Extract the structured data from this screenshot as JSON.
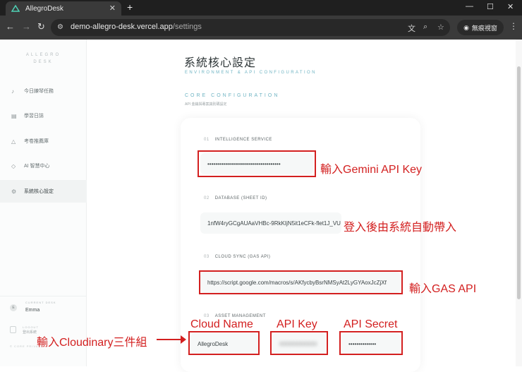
{
  "browser": {
    "tab_title": "AllegroDesk",
    "tab_close": "✕",
    "new_tab": "+",
    "url_host": "demo-allegro-desk.vercel.app",
    "url_path": "/settings",
    "incognito_label": "無痕視窗",
    "window_controls": [
      "—",
      "☐",
      "✕"
    ]
  },
  "sidebar": {
    "brand_line1": "ALLEGRO",
    "brand_line2": "DESK",
    "items": [
      {
        "label": "今日練琴任務",
        "icon": "music-icon"
      },
      {
        "label": "學習日誌",
        "icon": "journal-icon"
      },
      {
        "label": "考卷推薦庫",
        "icon": "mountain-icon"
      },
      {
        "label": "AI 智慧中心",
        "icon": "ai-icon"
      },
      {
        "label": "系統核心設定",
        "icon": "gear-icon",
        "active": true
      }
    ],
    "user_caption": "CURRENT DESK",
    "user_name": "Emma",
    "logout_caption": "LOGOUT",
    "logout_label": "登出系統",
    "footer": "© CORE PRIVATE"
  },
  "main": {
    "title": "系統核心設定",
    "subtitle": "ENVIRONMENT & API CONFIGURATION",
    "section_title": "CORE CONFIGURATION",
    "section_desc": "API 金鑰與專案識別碼設定",
    "fields": [
      {
        "num": "01",
        "label": "INTELLIGENCE SERVICE",
        "value": "•••••••••••••••••••••••••••••••••••••"
      },
      {
        "num": "02",
        "label": "DATABASE (SHEET ID)",
        "value": "1nfW4ryGCgAUAaVHBc-9RkKIjN5it1eCFk-flet1J_VU"
      },
      {
        "num": "03",
        "label": "CLOUD SYNC (GAS API)",
        "value": "https://script.google.com/macros/s/AKfycbyBsrNMSyAt2LyGYAoxJcZjXf"
      },
      {
        "num": "03",
        "label": "ASSET MANAGEMENT",
        "value": ""
      }
    ],
    "asset_fields": [
      {
        "value": "AllegroDesk"
      },
      {
        "value": "000000000000"
      },
      {
        "value": "••••••••••••••"
      }
    ]
  },
  "annotations": {
    "gemini": "輸入Gemini API Key",
    "sheet": "登入後由系統自動帶入",
    "gas": "輸入GAS API",
    "cloudinary": "輸入Cloudinary三件組",
    "cloud_name": "Cloud Name",
    "api_key": "API Key",
    "api_secret": "API Secret"
  },
  "colors": {
    "accent": "#6fb4c3",
    "annotation": "#d32020"
  }
}
